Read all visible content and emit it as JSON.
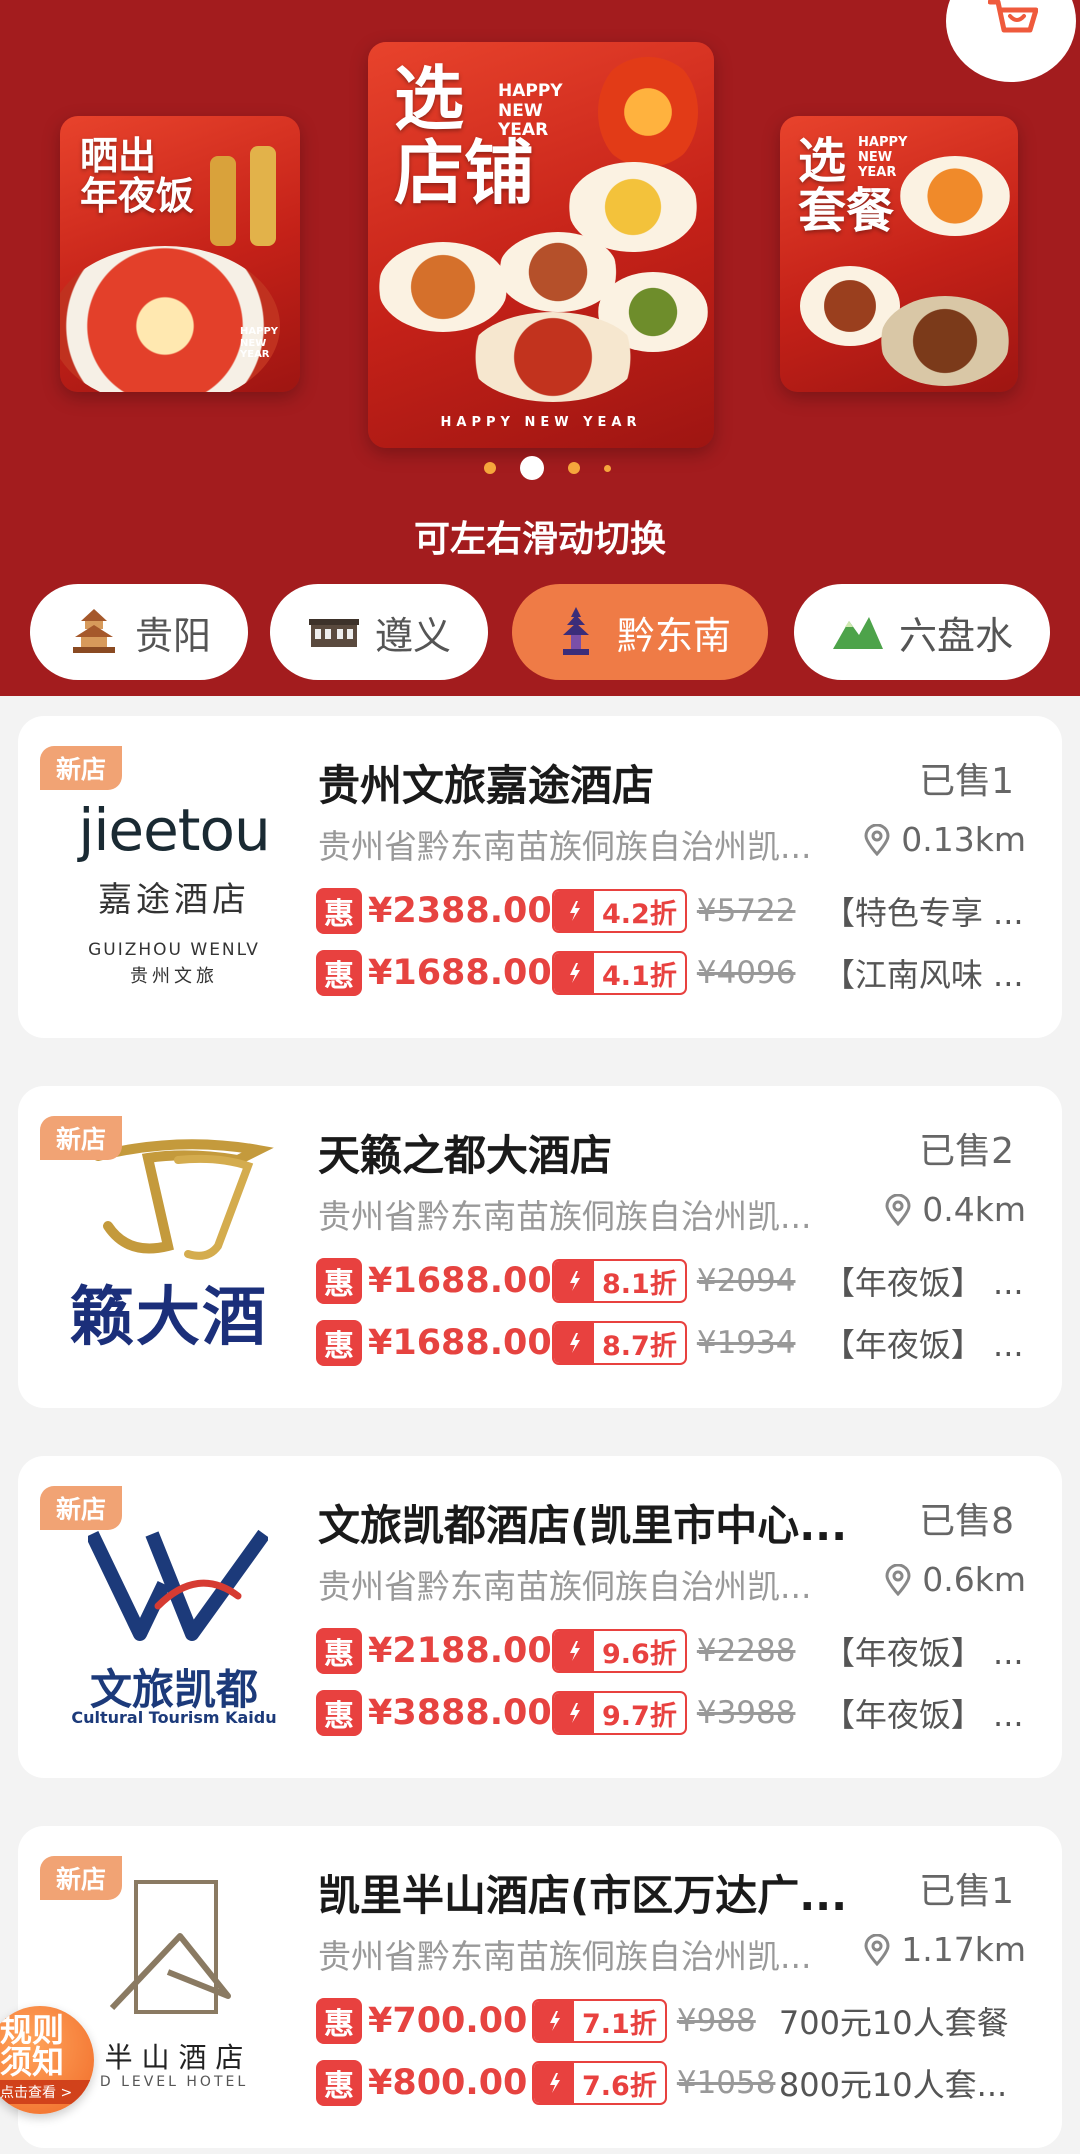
{
  "banner": {
    "cards": [
      {
        "title": "晒出\n年夜饭",
        "sub": "HAPPY\nNEW\nYEAR",
        "footer": ""
      },
      {
        "title": "选\n店铺",
        "sub": "HAPPY\nNEW\nYEAR",
        "footer": "HAPPY NEW YEAR"
      },
      {
        "title": "选\n套餐",
        "sub": "HAPPY\nNEW\nYEAR",
        "footer": ""
      }
    ],
    "active_slide": 2,
    "swipe_hint": "可左右滑动切换"
  },
  "city_tabs": [
    {
      "label": "贵阳",
      "active": false
    },
    {
      "label": "遵义",
      "active": false
    },
    {
      "label": "黔东南",
      "active": true
    },
    {
      "label": "六盘水",
      "active": false
    }
  ],
  "stores": [
    {
      "badge": "新店",
      "name": "贵州文旅嘉途酒店",
      "sold": "已售1",
      "address": "贵州省黔东南苗族侗族自治州凯...",
      "distance": "0.13km",
      "logo": {
        "main": "jieetou",
        "sub": "嘉途酒店",
        "caption": "GUIZHOU WENLV",
        "caption2": "贵州文旅"
      },
      "deals": [
        {
          "tag": "惠",
          "price": "¥2388.00",
          "discount": "4.2折",
          "original": "¥5722",
          "package": "【特色专享 ..."
        },
        {
          "tag": "惠",
          "price": "¥1688.00",
          "discount": "4.1折",
          "original": "¥4096",
          "package": "【江南风味 ..."
        }
      ]
    },
    {
      "badge": "新店",
      "name": "天籁之都大酒店",
      "sold": "已售2",
      "address": "贵州省黔东南苗族侗族自治州凯...",
      "distance": "0.4km",
      "logo": {
        "main": "籁大酒"
      },
      "deals": [
        {
          "tag": "惠",
          "price": "¥1688.00",
          "discount": "8.1折",
          "original": "¥2094",
          "package": "【年夜饭】 ..."
        },
        {
          "tag": "惠",
          "price": "¥1688.00",
          "discount": "8.7折",
          "original": "¥1934",
          "package": "【年夜饭】 ..."
        }
      ]
    },
    {
      "badge": "新店",
      "name": "文旅凯都酒店(凯里市中心...",
      "sold": "已售8",
      "address": "贵州省黔东南苗族侗族自治州凯...",
      "distance": "0.6km",
      "logo": {
        "main": "文旅凯都",
        "sub": "Cultural Tourism Kaidu"
      },
      "deals": [
        {
          "tag": "惠",
          "price": "¥2188.00",
          "discount": "9.6折",
          "original": "¥2288",
          "package": "【年夜饭】 ..."
        },
        {
          "tag": "惠",
          "price": "¥3888.00",
          "discount": "9.7折",
          "original": "¥3988",
          "package": "【年夜饭】 ..."
        }
      ]
    },
    {
      "badge": "新店",
      "name": "凯里半山酒店(市区万达广...",
      "sold": "已售1",
      "address": "贵州省黔东南苗族侗族自治州凯...",
      "distance": "1.17km",
      "logo": {
        "main": "半 山 酒 店",
        "sub": "D LEVEL HOTEL"
      },
      "deals": [
        {
          "tag": "惠",
          "price": "¥700.00",
          "discount": "7.1折",
          "original": "¥988",
          "package": "700元10人套餐"
        },
        {
          "tag": "惠",
          "price": "¥800.00",
          "discount": "7.6折",
          "original": "¥1058",
          "package": "800元10人套..."
        }
      ]
    }
  ],
  "rules_button": {
    "title": "规则\n须知",
    "sub": "点击查看 >"
  },
  "colors": {
    "banner_bg": "#a31c1e",
    "active_tab": "#ef7b46",
    "price_red": "#e64340",
    "badge_orange": "#f1a374"
  }
}
